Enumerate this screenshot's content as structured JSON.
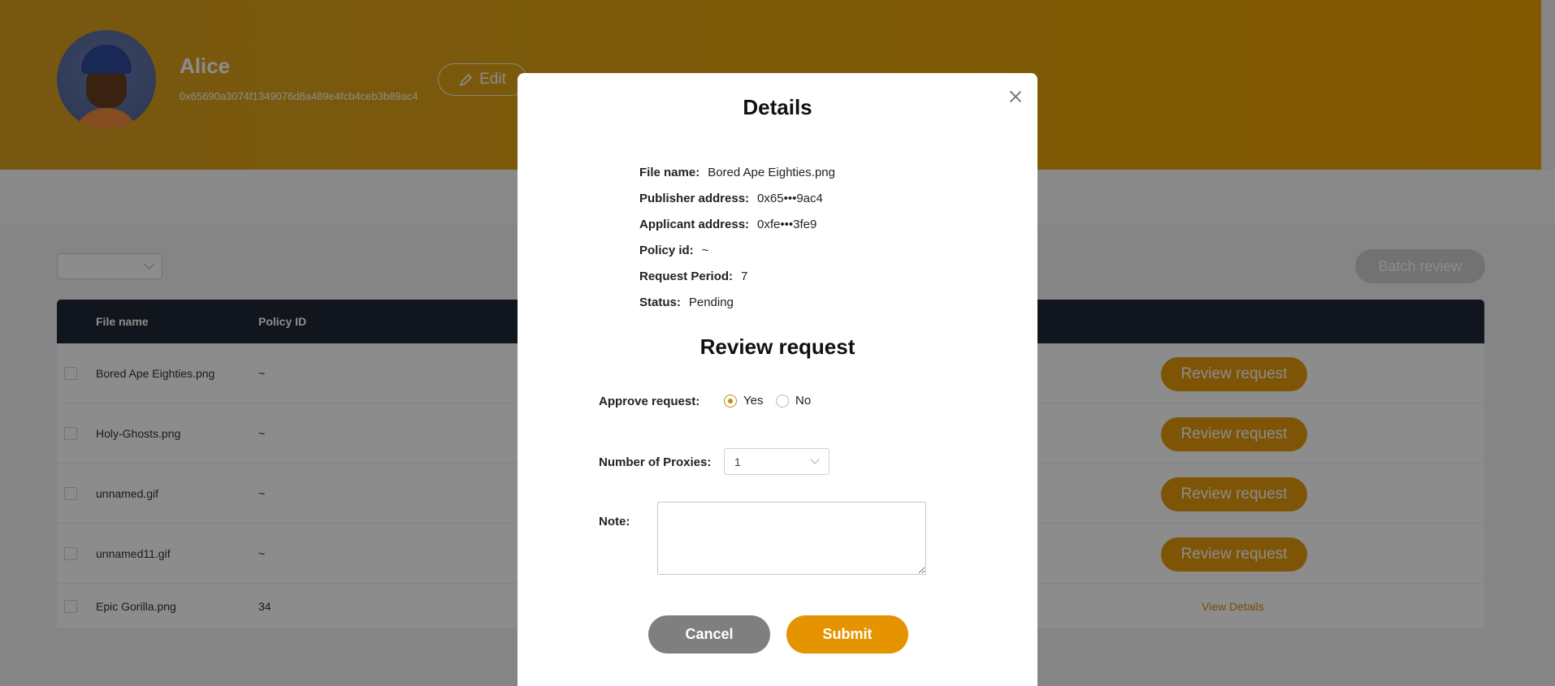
{
  "profile": {
    "name": "Alice",
    "address": "0x65690a3074f1349076d8a489e4fcb4ceb3b89ac4",
    "edit_label": "Edit"
  },
  "toolbar": {
    "filter_value": "",
    "batch_review_label": "Batch review"
  },
  "table": {
    "columns": [
      "File name",
      "Policy ID"
    ],
    "rows": [
      {
        "file_name": "Bored Ape Eighties.png",
        "policy_id": "~",
        "action": "Review request"
      },
      {
        "file_name": "Holy-Ghosts.png",
        "policy_id": "~",
        "action": "Review request"
      },
      {
        "file_name": "unnamed.gif",
        "policy_id": "~",
        "action": "Review request"
      },
      {
        "file_name": "unnamed11.gif",
        "policy_id": "~",
        "action": "Review request"
      },
      {
        "file_name": "Epic Gorilla.png",
        "policy_id": "34",
        "action": "View Details"
      }
    ]
  },
  "modal": {
    "title": "Details",
    "details": [
      {
        "label": "File name:",
        "value": "Bored Ape Eighties.png"
      },
      {
        "label": "Publisher address:",
        "value": "0x65•••9ac4"
      },
      {
        "label": "Applicant address:",
        "value": "0xfe•••3fe9"
      },
      {
        "label": "Policy id:",
        "value": "~"
      },
      {
        "label": "Request Period:",
        "value": "7"
      },
      {
        "label": "Status:",
        "value": "Pending"
      }
    ],
    "review_title": "Review request",
    "approve_label": "Approve request:",
    "approve_options": [
      "Yes",
      "No"
    ],
    "approve_selected": "Yes",
    "proxies_label": "Number of Proxies:",
    "proxies_value": "1",
    "note_label": "Note:",
    "note_value": "",
    "cancel_label": "Cancel",
    "submit_label": "Submit"
  },
  "colors": {
    "accent": "#e59400",
    "banner": "#e3a50f",
    "table_header": "#1f2937",
    "cancel": "#7f7f7f"
  }
}
